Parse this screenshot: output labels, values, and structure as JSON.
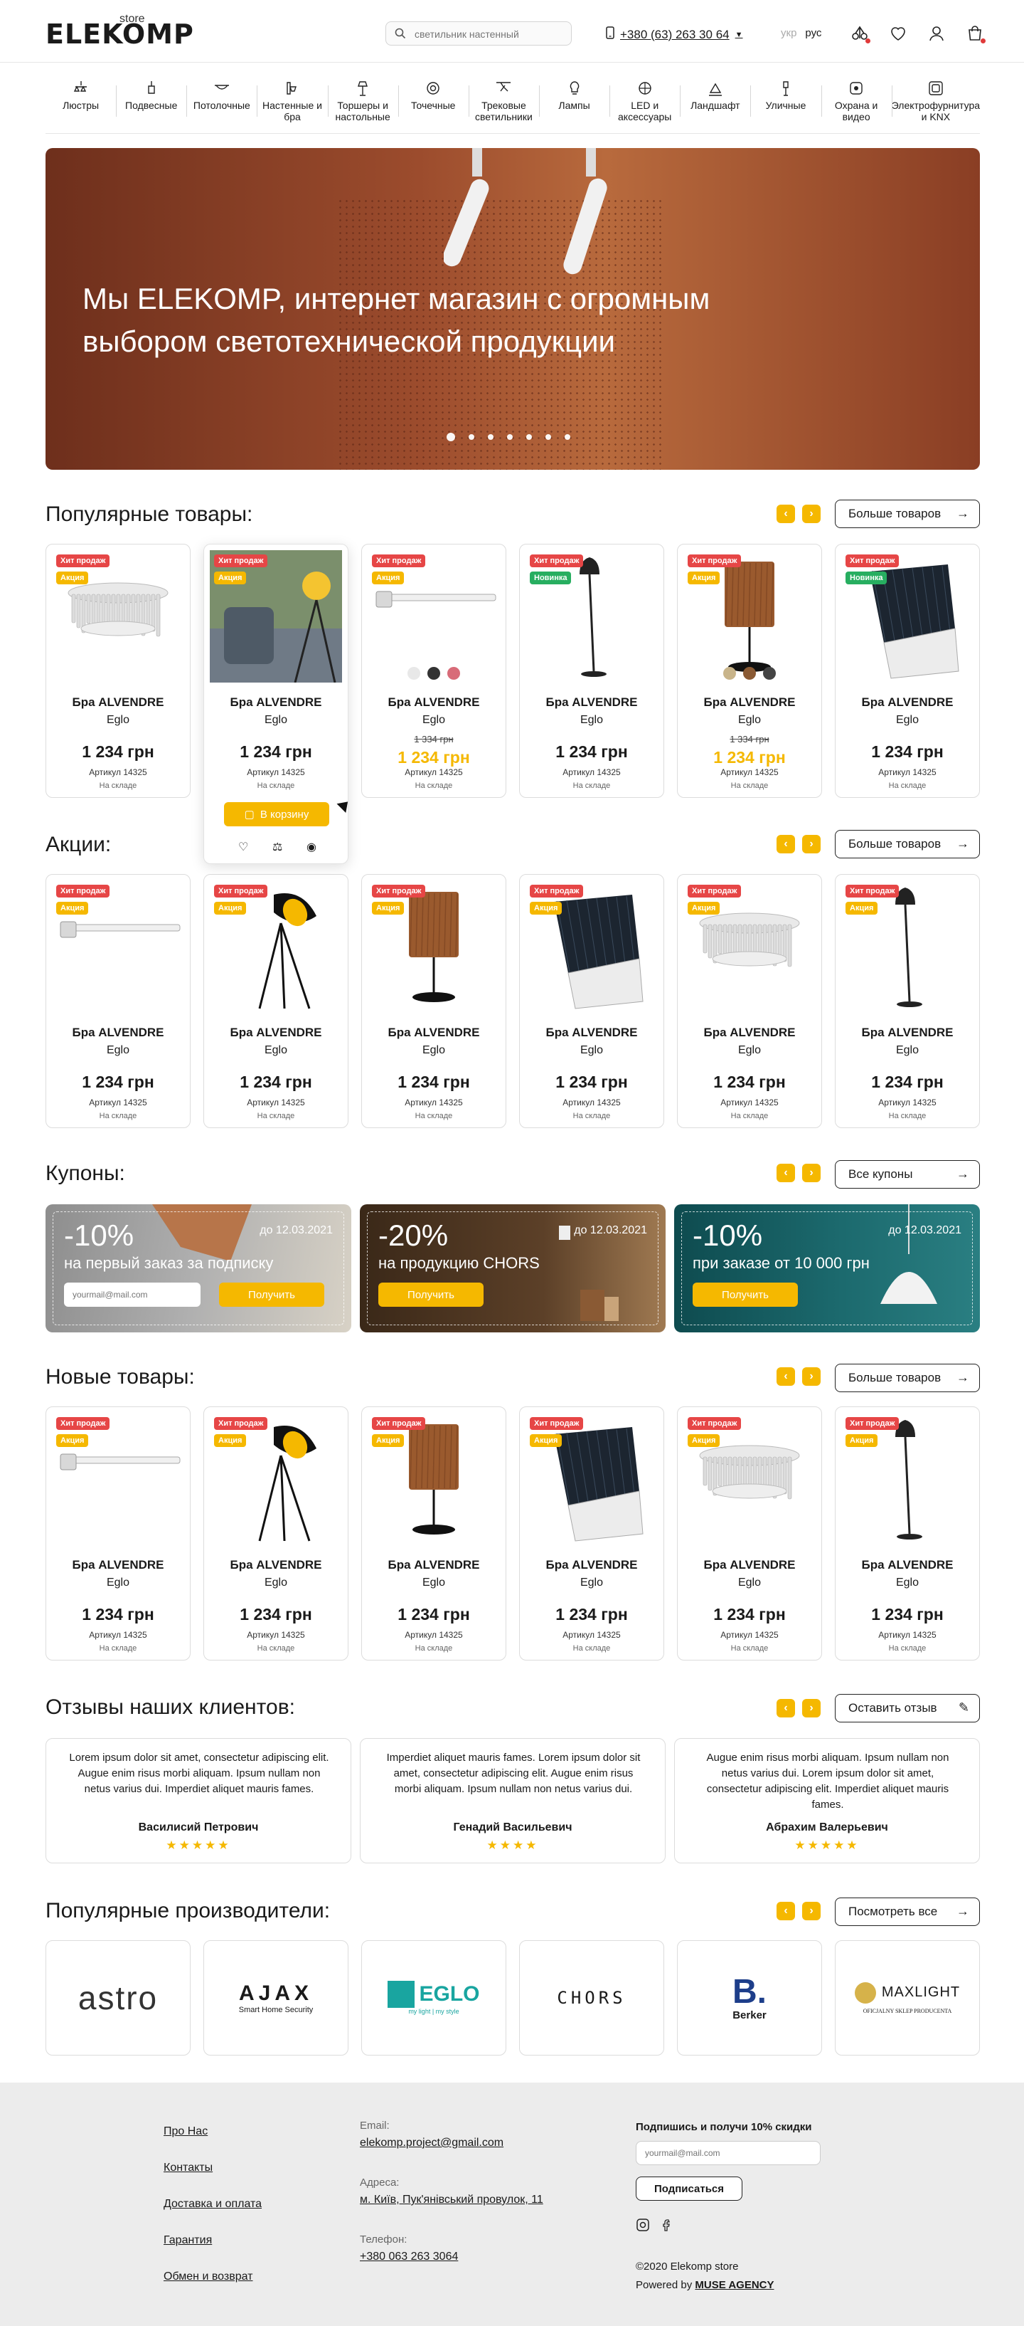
{
  "header": {
    "logo_text": "ELEKOMP",
    "logo_sub": "store",
    "search_placeholder": "светильник настенный",
    "phone": "+380 (63) 263 30 64",
    "lang": [
      "укр",
      "рус"
    ],
    "icons": [
      "compare-icon",
      "heart-icon",
      "user-icon",
      "cart-icon"
    ]
  },
  "categories": [
    {
      "label": "Люстры",
      "icon": "chandelier-icon"
    },
    {
      "label": "Подвесные",
      "icon": "pendant-icon"
    },
    {
      "label": "Потолочные",
      "icon": "ceiling-icon"
    },
    {
      "label": "Настенные и бра",
      "icon": "wall-lamp-icon"
    },
    {
      "label": "Торшеры и настольные",
      "icon": "floor-lamp-icon"
    },
    {
      "label": "Точечные",
      "icon": "spot-icon"
    },
    {
      "label": "Трековые светильники",
      "icon": "track-icon"
    },
    {
      "label": "Лампы",
      "icon": "bulb-icon"
    },
    {
      "label": "LED и аксессуары",
      "icon": "led-icon"
    },
    {
      "label": "Ландшафт",
      "icon": "landscape-icon"
    },
    {
      "label": "Уличные",
      "icon": "outdoor-icon"
    },
    {
      "label": "Охрана и видео",
      "icon": "camera-icon"
    },
    {
      "label": "Электрофурнитура и KNX",
      "icon": "socket-icon"
    }
  ],
  "hero": {
    "title": "Мы ELEKOMP, интернет магазин с огромным выбором светотехнической продукции",
    "slides": 8,
    "active_slide": 1
  },
  "badges": {
    "hit": "Хит продаж",
    "sale": "Акция",
    "new": "Новинка"
  },
  "card_common": {
    "name": "Бра ALVENDRE",
    "brand": "Eglo",
    "price": "1 234 грн",
    "old_price": "1 334 грн",
    "article": "Артикул 14325",
    "stock": "На складе"
  },
  "sections": {
    "popular": {
      "title": "Популярные товары:",
      "more": "Больше товаров"
    },
    "sales": {
      "title": "Акции:",
      "more": "Больше товаров"
    },
    "coupons": {
      "title": "Купоны:",
      "more": "Все купоны"
    },
    "new": {
      "title": "Новые товары:",
      "more": "Больше товаров"
    },
    "reviews": {
      "title": "Отзывы наших клиентов:",
      "more": "Оставить отзыв"
    },
    "brands": {
      "title": "Популярные производители:",
      "more": "Посмотреть все"
    }
  },
  "hover_card": {
    "cart_label": "В корзину"
  },
  "colors": {
    "accent": "#f5b800",
    "hit": "#e64646",
    "new": "#27ae60"
  },
  "coupons": [
    {
      "pct": "-10%",
      "date": "до 12.03.2021",
      "text": "на первый заказ за подписку",
      "email_placeholder": "yourmail@mail.com",
      "btn": "Получить"
    },
    {
      "pct": "-20%",
      "date": "до 12.03.2021",
      "text": "на продукцию CHORS",
      "btn": "Получить"
    },
    {
      "pct": "-10%",
      "date": "до 12.03.2021",
      "text": "при заказе от 10 000 грн",
      "btn": "Получить"
    }
  ],
  "reviews": [
    {
      "text": "Lorem ipsum dolor sit amet, consectetur adipiscing elit. Augue enim risus morbi aliquam. Ipsum nullam non netus varius dui. Imperdiet aliquet mauris fames.",
      "name": "Василисий Петрович",
      "stars": "★★★★★"
    },
    {
      "text": "Imperdiet aliquet mauris fames. Lorem ipsum dolor sit amet, consectetur adipiscing elit. Augue enim risus morbi aliquam. Ipsum nullam non netus varius dui.",
      "name": "Генадий Васильевич",
      "stars": "★★★★"
    },
    {
      "text": "Augue enim risus morbi aliquam. Ipsum nullam non netus varius dui. Lorem ipsum dolor sit amet, consectetur adipiscing elit. Imperdiet aliquet mauris fames.",
      "name": "Абрахим Валерьевич",
      "stars": "★★★★★"
    }
  ],
  "brands": [
    {
      "name": "astro"
    },
    {
      "name": "AJAX",
      "sub": "Smart Home Security"
    },
    {
      "name": "EGLO",
      "sub": "my light | my style"
    },
    {
      "name": "CHORS"
    },
    {
      "name": "Berker"
    },
    {
      "name": "MAXLIGHT",
      "sub": "OFICJALNY SKLEP PRODUCENTA"
    }
  ],
  "footer": {
    "links": [
      "Про Нас",
      "Контакты",
      "Доставка и оплата",
      "Гарантия",
      "Обмен и возврат"
    ],
    "email_label": "Email:",
    "email": "elekomp.project@gmail.com",
    "address_label": "Адреса:",
    "address": "м. Київ, Пук'янівський провулок, 11",
    "phone_label": "Телефон:",
    "phone": "+380 063 263 3064",
    "subscribe_title": "Подпишись и получи 10% скидки",
    "subscribe_placeholder": "yourmail@mail.com",
    "subscribe_btn": "Подписаться",
    "copyright": "©2020 Elekomp store",
    "powered_prefix": "Powered by",
    "powered_by": "MUSE AGENCY"
  }
}
